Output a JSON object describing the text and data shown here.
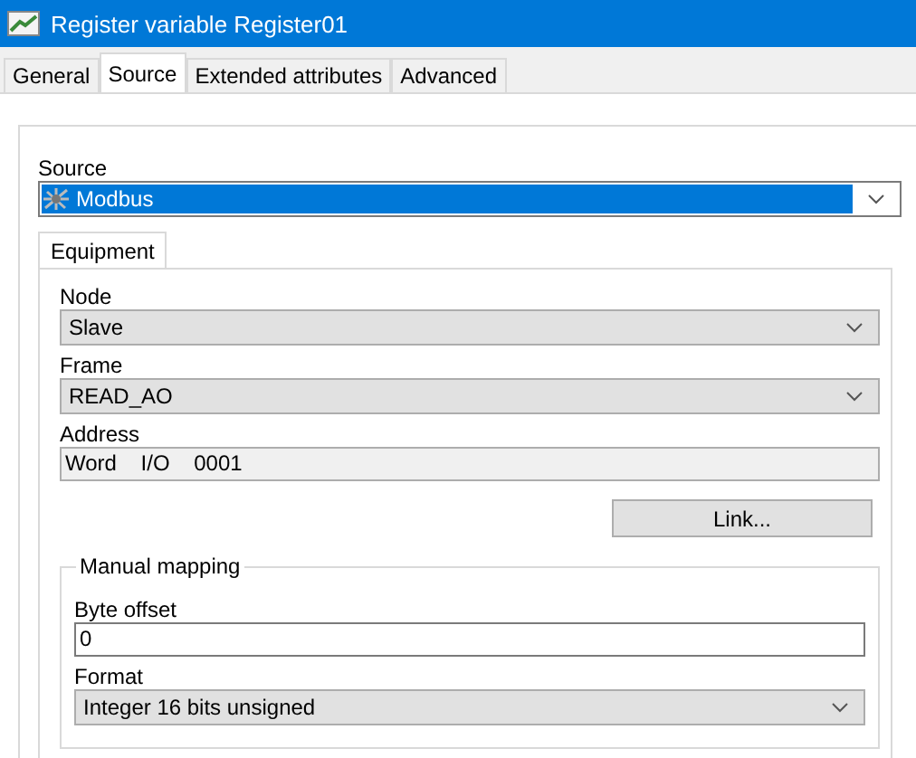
{
  "window": {
    "title": "Register variable Register01"
  },
  "tabs": [
    {
      "label": "General",
      "selected": false
    },
    {
      "label": "Source",
      "selected": true
    },
    {
      "label": "Extended attributes",
      "selected": false
    },
    {
      "label": "Advanced",
      "selected": false
    }
  ],
  "source": {
    "label": "Source",
    "value": "Modbus",
    "focused": true
  },
  "equipment_tabs": [
    {
      "label": "Equipment",
      "selected": true
    }
  ],
  "equipment": {
    "node": {
      "label": "Node",
      "value": "Slave"
    },
    "frame": {
      "label": "Frame",
      "value": "READ_AO"
    },
    "address": {
      "label": "Address",
      "value": "Word    I/O    0001"
    },
    "link_button": "Link..."
  },
  "manual_mapping": {
    "title": "Manual mapping",
    "byte_offset": {
      "label": "Byte offset",
      "value": "0"
    },
    "format": {
      "label": "Format",
      "value": "Integer 16 bits unsigned"
    }
  }
}
